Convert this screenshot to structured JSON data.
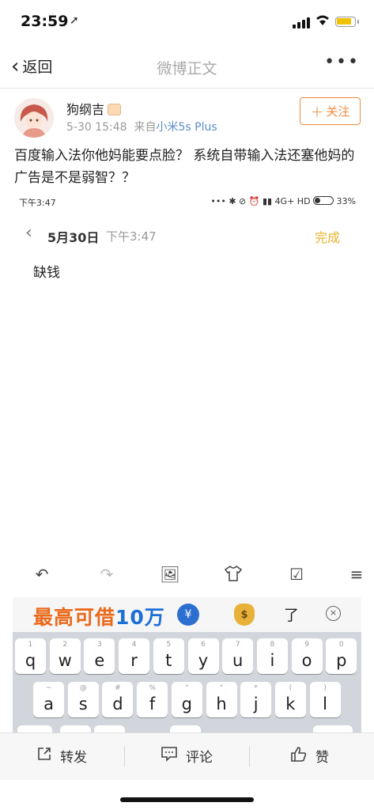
{
  "status_bar": {
    "time": "23:59",
    "location_icon": "location-arrow-icon"
  },
  "nav": {
    "back_label": "返回",
    "title": "微博正文",
    "more": "•••"
  },
  "post": {
    "username": "狗纲吉",
    "date": "5-30 15:48",
    "source_prefix": "来自",
    "source": "小米5s Plus",
    "follow_label": "关注",
    "text": "百度输入法你他妈能要点脸？ 系统自带输入法还塞他妈的广告是不是弱智？？"
  },
  "screenshot": {
    "status_time": "下午3:47",
    "status_right": "4G+ HD",
    "battery": "33%",
    "memo_date": "5月30日",
    "memo_time": "下午3:47",
    "memo_done": "完成",
    "memo_text": "缺钱",
    "ad_text": "最高可借",
    "ad_amount": "10万",
    "ad_coin": "¥",
    "moneybag": "$",
    "candidate": "了",
    "close": "×",
    "row1": [
      {
        "hint": "1",
        "ch": "q"
      },
      {
        "hint": "2",
        "ch": "w"
      },
      {
        "hint": "3",
        "ch": "e"
      },
      {
        "hint": "4",
        "ch": "r"
      },
      {
        "hint": "5",
        "ch": "t"
      },
      {
        "hint": "6",
        "ch": "y"
      },
      {
        "hint": "7",
        "ch": "u"
      },
      {
        "hint": "8",
        "ch": "i"
      },
      {
        "hint": "9",
        "ch": "o"
      },
      {
        "hint": "0",
        "ch": "p"
      }
    ],
    "row2": [
      {
        "hint": "~",
        "ch": "a"
      },
      {
        "hint": "@",
        "ch": "s"
      },
      {
        "hint": "#",
        "ch": "d"
      },
      {
        "hint": "%",
        "ch": "f"
      },
      {
        "hint": "\"",
        "ch": "g"
      },
      {
        "hint": "\"",
        "ch": "h"
      },
      {
        "hint": "*",
        "ch": "j"
      },
      {
        "hint": "(",
        "ch": "k"
      },
      {
        "hint": ")",
        "ch": "l"
      }
    ]
  },
  "actions": {
    "repost": "转发",
    "comment": "评论",
    "like": "赞"
  },
  "colors": {
    "accent_orange": "#f08a3c",
    "source_blue": "#5a8ec9",
    "done_yellow": "#e8b228"
  }
}
